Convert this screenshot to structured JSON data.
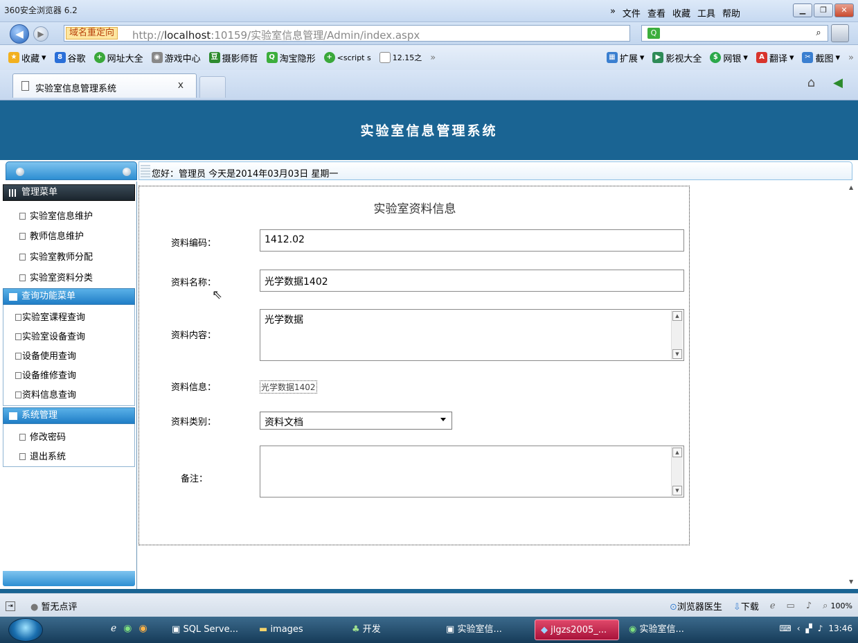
{
  "window": {
    "title": "360安全浏览器 6.2",
    "menu": [
      "»",
      "文件",
      "查看",
      "收藏",
      "工具",
      "帮助"
    ]
  },
  "address": {
    "redirect_label": "域名重定向",
    "url_prefix": "http://",
    "url_host": "localhost",
    "url_rest": ":10159/实验室信息管理/Admin/index.aspx"
  },
  "favorites": {
    "items": [
      "收藏",
      "谷歌",
      "网址大全",
      "游戏中心",
      "摄影师哲",
      "淘宝隐形",
      "<script s",
      "12.15之",
      "»"
    ],
    "right": [
      "扩展",
      "影视大全",
      "网银",
      "翻译",
      "截图",
      "»"
    ]
  },
  "tabs": [
    {
      "label": "实验室信息管理系统",
      "close": "x"
    }
  ],
  "app": {
    "title": "实验室信息管理系统",
    "greeting": "您好：管理员   今天是2014年03月03日   星期一"
  },
  "sidebar": {
    "sections": [
      {
        "title": "管理菜单",
        "items": [
          "实验室信息维护",
          "教师信息维护",
          "实验室教师分配",
          "实验室资料分类"
        ]
      },
      {
        "title": "查询功能菜单",
        "items": [
          "实验室课程查询",
          "实验室设备查询",
          "设备使用查询",
          "设备维修查询",
          "资料信息查询"
        ]
      },
      {
        "title": "系统管理",
        "items": [
          "修改密码",
          "退出系统"
        ]
      }
    ]
  },
  "form": {
    "title": "实验室资料信息",
    "code_label": "资料编码：",
    "code_value": "1412.02",
    "name_label": "资料名称：",
    "name_value": "光学数据1402",
    "content_label": "资料内容：",
    "content_value": "光学数据",
    "info_label": "资料信息：",
    "info_value": "光学数据1402",
    "category_label": "资料类别：",
    "category_value": "资料文档",
    "remark_label": "备注：",
    "remark_value": ""
  },
  "status": {
    "rating": "暂无点评",
    "right": [
      "浏览器医生",
      "下载",
      "100%"
    ]
  },
  "taskbar": {
    "tasks": [
      "SQL Serve...",
      "images",
      "开发",
      "实验室信...",
      "jlgzs2005_...",
      "实验室信..."
    ],
    "clock": "13:46"
  }
}
